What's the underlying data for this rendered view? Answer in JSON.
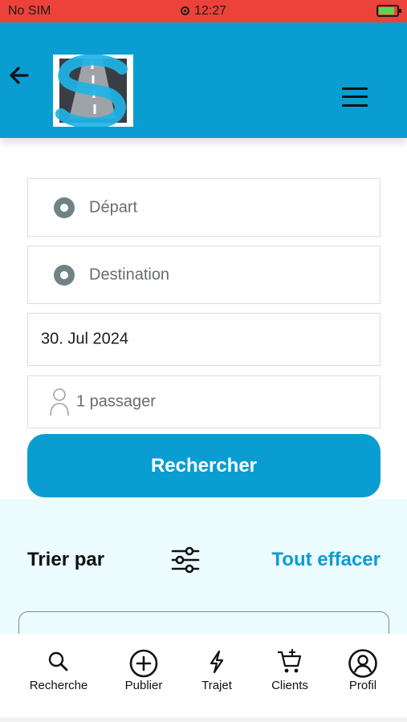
{
  "status_bar": {
    "carrier": "No SIM",
    "time": "12:27",
    "battery_level": 0.85,
    "battery_color": "#5bd64c",
    "background": "#ec4239"
  },
  "header": {
    "background": "#0a9dd1",
    "back_icon": "arrow-left-icon",
    "logo": "road-s-logo",
    "menu_icon": "hamburger-menu-icon"
  },
  "search_form": {
    "depart_placeholder": "Départ",
    "destination_placeholder": "Destination",
    "date_value": "30. Jul 2024",
    "passengers_value": "1 passager",
    "search_button": "Rechercher"
  },
  "sort_panel": {
    "title": "Trier par",
    "filter_icon": "sliders-icon",
    "clear_label": "Tout effacer",
    "accent": "#0a9dd1"
  },
  "bottom_nav": {
    "items": [
      {
        "label": "Recherche",
        "icon": "search-icon"
      },
      {
        "label": "Publier",
        "icon": "plus-circle-icon"
      },
      {
        "label": "Trajet",
        "icon": "lightning-icon"
      },
      {
        "label": "Clients",
        "icon": "cart-icon"
      },
      {
        "label": "Profil",
        "icon": "user-circle-icon"
      }
    ]
  }
}
